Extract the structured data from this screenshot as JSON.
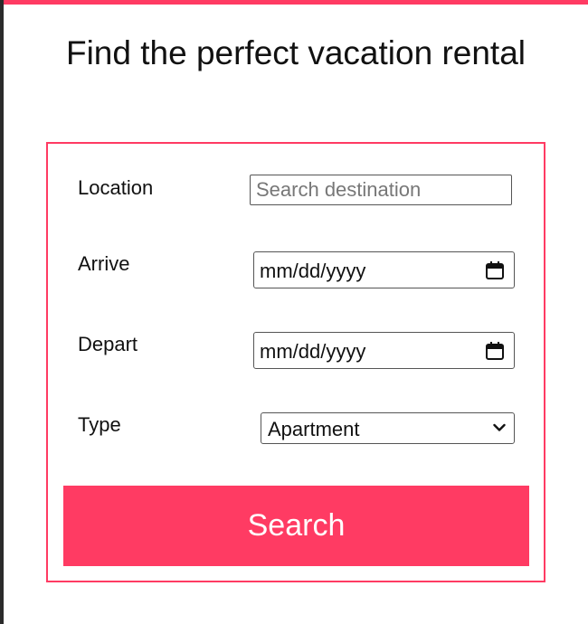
{
  "page": {
    "title": "Find the perfect vacation rental"
  },
  "form": {
    "location": {
      "label": "Location",
      "placeholder": "Search destination",
      "value": ""
    },
    "arrive": {
      "label": "Arrive",
      "value": "mm/dd/yyyy"
    },
    "depart": {
      "label": "Depart",
      "value": "mm/dd/yyyy"
    },
    "type": {
      "label": "Type",
      "selected": "Apartment"
    },
    "search_label": "Search"
  },
  "icons": {
    "calendar": "calendar-icon",
    "dropdown": "chevron-down-icon"
  },
  "colors": {
    "accent": "#ff3b63",
    "button_text": "#ffffff",
    "text": "#111111"
  }
}
